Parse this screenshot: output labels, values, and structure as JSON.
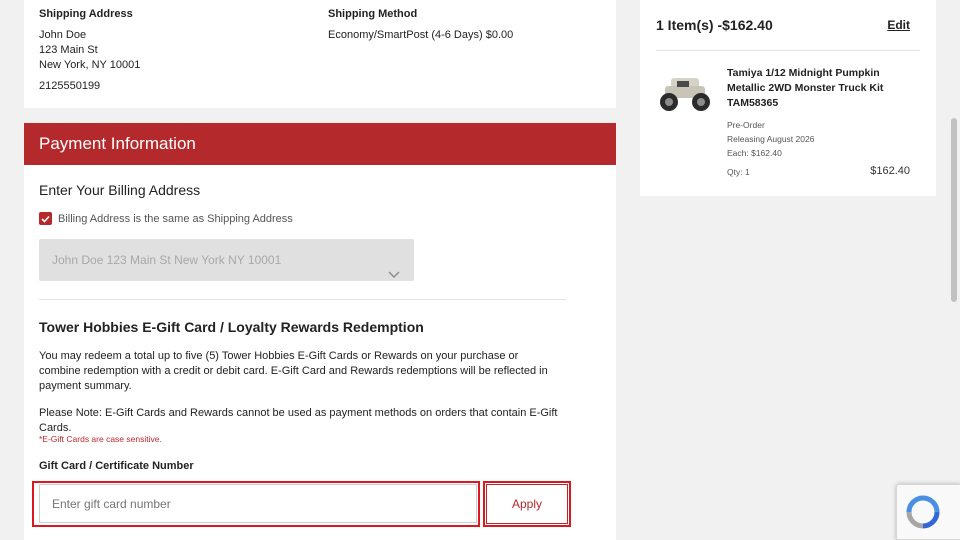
{
  "shipping": {
    "address_heading": "Shipping Address",
    "name": "John Doe",
    "street": "123 Main St",
    "city_line": "New York, NY 10001",
    "phone": "2125550199",
    "method_heading": "Shipping Method",
    "method_value": "Economy/SmartPost (4-6 Days) $0.00"
  },
  "payment": {
    "header": "Payment Information",
    "billing_title": "Enter Your Billing Address",
    "same_as_shipping_label": "Billing Address is the same as Shipping Address",
    "same_as_shipping_checked": true,
    "address_select_value": "John Doe 123 Main St New York NY 10001"
  },
  "gift": {
    "title": "Tower Hobbies E-Gift Card / Loyalty Rewards Redemption",
    "paragraph1": "You may redeem a total up to five (5) Tower Hobbies E-Gift Cards or Rewards on your purchase or combine redemption with a credit or debit card. E-Gift Card and Rewards redemptions will be reflected in payment summary.",
    "paragraph2": "Please Note: E-Gift Cards and Rewards cannot be used as payment methods on orders that contain E-Gift Cards.",
    "case_note": "*E-Gift Cards are case sensitive.",
    "field_label": "Gift Card / Certificate Number",
    "input_placeholder": "Enter gift card number",
    "input_value": "",
    "apply_label": "Apply"
  },
  "summary": {
    "title": "1 Item(s) -$162.40",
    "edit_label": "Edit",
    "product": {
      "name_line1": "Tamiya 1/12 Midnight Pumpkin",
      "name_line2": "Metallic 2WD Monster Truck Kit",
      "sku": "TAM58365",
      "status": "Pre-Order",
      "release": "Releasing August 2026",
      "each_price": "Each: $162.40",
      "qty": "Qty: 1",
      "line_total": "$162.40"
    }
  },
  "colors": {
    "brand_red": "#b4292c",
    "highlight_red": "#e0161f"
  }
}
